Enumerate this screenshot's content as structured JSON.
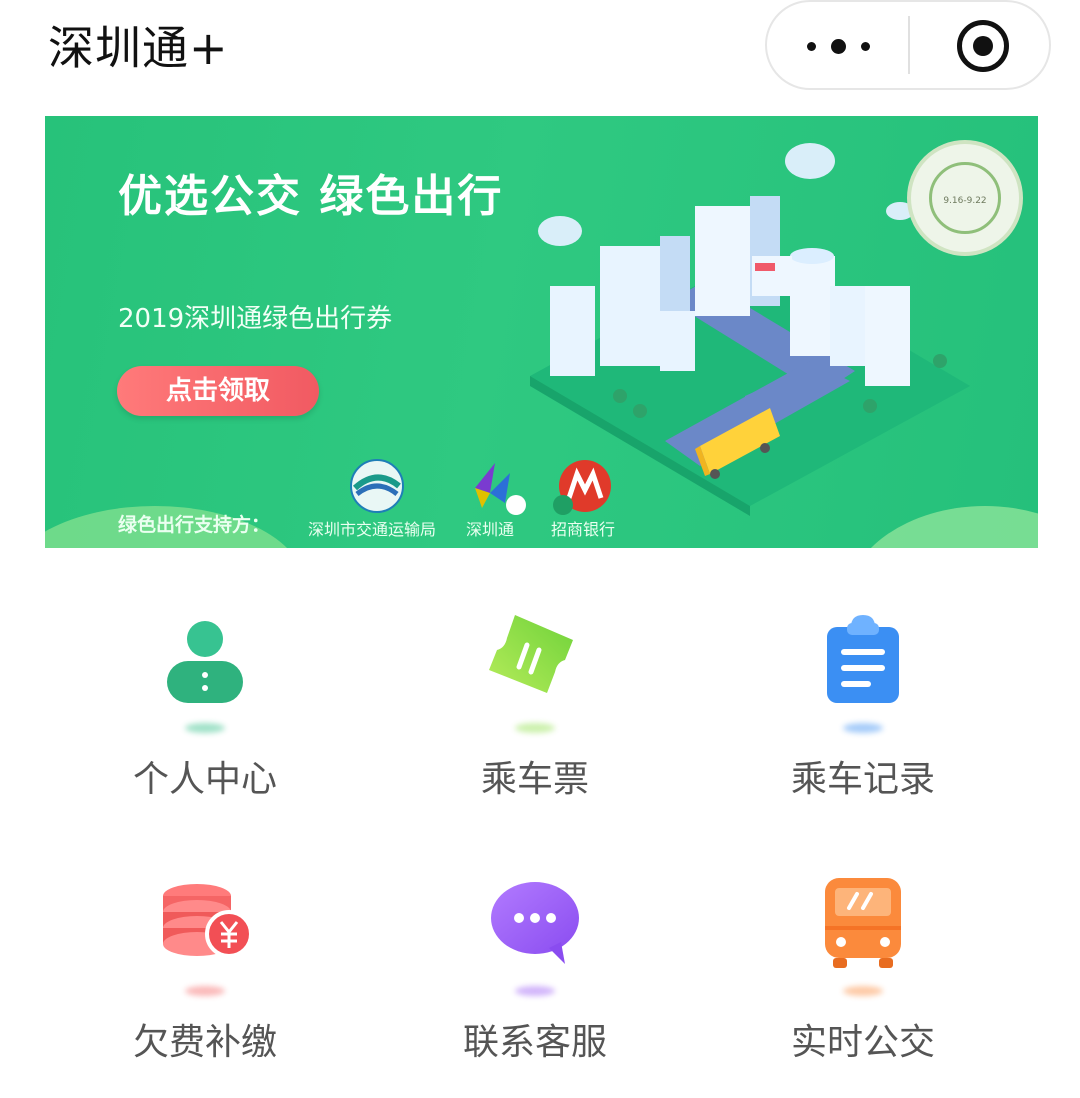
{
  "header": {
    "title": "深圳通+"
  },
  "banner": {
    "headline": "优选公交 绿色出行",
    "subtitle": "2019深圳通绿色出行券",
    "button_label": "点击领取",
    "supporters_label": "绿色出行支持方：",
    "sponsors": [
      "深圳市交通运输局",
      "深圳通",
      "招商银行"
    ],
    "seal_text": "9.16-9.22",
    "carousel": {
      "slide_count": 2,
      "active_index": 0
    }
  },
  "grid": {
    "items": [
      {
        "label": "个人中心",
        "icon": "person-icon",
        "color": "#2fbe86"
      },
      {
        "label": "乘车票",
        "icon": "ticket-icon",
        "color": "#8fe04a"
      },
      {
        "label": "乘车记录",
        "icon": "clipboard-icon",
        "color": "#3b8ff3"
      },
      {
        "label": "欠费补缴",
        "icon": "coins-yen-icon",
        "color": "#f56565"
      },
      {
        "label": "联系客服",
        "icon": "chat-bubble-icon",
        "color": "#9b5cf5"
      },
      {
        "label": "实时公交",
        "icon": "bus-icon",
        "color": "#fb8a3c"
      }
    ]
  }
}
